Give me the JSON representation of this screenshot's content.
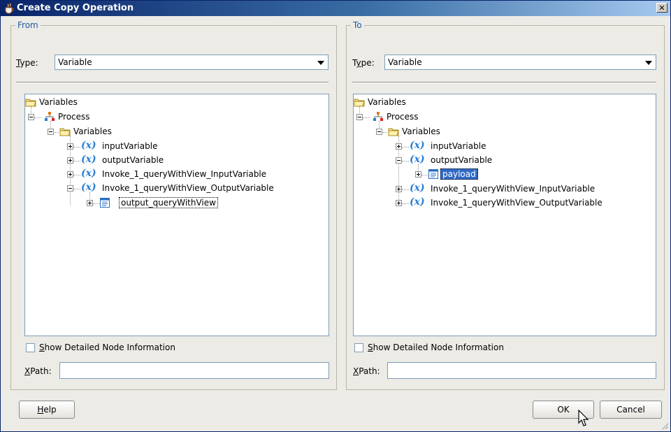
{
  "window": {
    "title": "Create Copy Operation",
    "close_glyph": "✕"
  },
  "from": {
    "legend": "From",
    "type_label_pre": "",
    "type_label_u": "T",
    "type_label_post": "ype:",
    "type_value": "Variable",
    "tree": [
      {
        "label": "Variables",
        "icon": "folder-icon"
      },
      {
        "label": "Process",
        "icon": "process-icon"
      },
      {
        "label": "Variables",
        "icon": "folder-icon"
      },
      {
        "label": "inputVariable",
        "icon": "variable-icon"
      },
      {
        "label": "outputVariable",
        "icon": "variable-icon"
      },
      {
        "label": "Invoke_1_queryWithView_InputVariable",
        "icon": "variable-icon"
      },
      {
        "label": "Invoke_1_queryWithView_OutputVariable",
        "icon": "variable-icon"
      },
      {
        "label": "output_queryWithView",
        "icon": "element-icon"
      }
    ],
    "checkbox_u": "S",
    "checkbox_rest": "how Detailed Node Information",
    "xpath_u": "X",
    "xpath_rest": "Path:",
    "xpath_value": ""
  },
  "to": {
    "legend": "To",
    "type_label_pre": "T",
    "type_label_u": "y",
    "type_label_post": "pe:",
    "type_value": "Variable",
    "tree": [
      {
        "label": "Variables",
        "icon": "folder-icon"
      },
      {
        "label": "Process",
        "icon": "process-icon"
      },
      {
        "label": "Variables",
        "icon": "folder-icon"
      },
      {
        "label": "inputVariable",
        "icon": "variable-icon"
      },
      {
        "label": "outputVariable",
        "icon": "variable-icon"
      },
      {
        "label": "payload",
        "icon": "element-icon"
      },
      {
        "label": "Invoke_1_queryWithView_InputVariable",
        "icon": "variable-icon"
      },
      {
        "label": "Invoke_1_queryWithView_OutputVariable",
        "icon": "variable-icon"
      }
    ],
    "checkbox_u": "S",
    "checkbox_rest": "how Detailed Node Information",
    "xpath_u": "X",
    "xpath_rest": "Path:",
    "xpath_value": ""
  },
  "buttons": {
    "help_u": "H",
    "help_rest": "elp",
    "ok": "OK",
    "cancel": "Cancel"
  },
  "icon_glyphs": {
    "variable": "(x)"
  }
}
